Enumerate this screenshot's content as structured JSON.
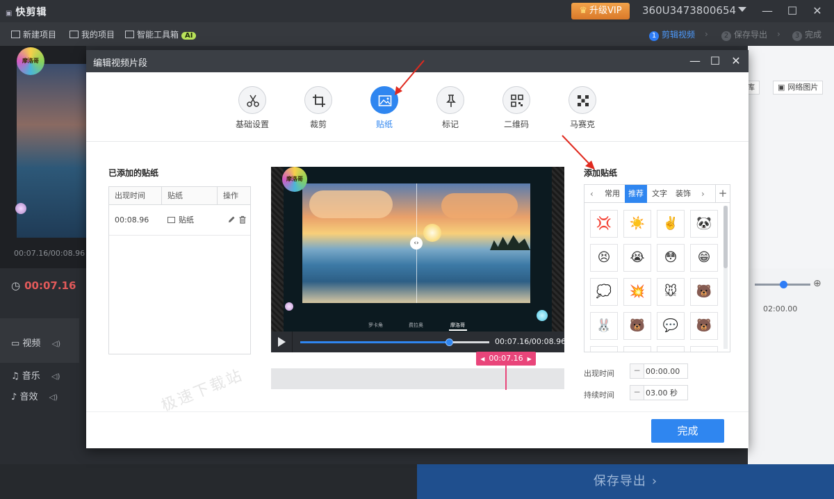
{
  "app": {
    "title": "快剪辑",
    "vip_label": "升级VIP",
    "user_id": "360U3473800654"
  },
  "toolbar": {
    "new_project": "新建项目",
    "my_projects": "我的项目",
    "smart_toolbox": "智能工具箱",
    "ai_badge": "AI",
    "steps": [
      {
        "num": "1",
        "label": "剪辑视频"
      },
      {
        "num": "2",
        "label": "保存导出"
      },
      {
        "num": "3",
        "label": "完成"
      }
    ]
  },
  "background": {
    "preview_time": "00:07.16/00:08.96",
    "timeline_time": "00:07.16",
    "ruler_time": "02:00.00",
    "right_buttons": [
      "库",
      "网络图片"
    ],
    "tracks": [
      "视频",
      "音乐",
      "音效"
    ],
    "save_export": "保存导出",
    "logo_text": "摩洛哥"
  },
  "modal": {
    "title": "编辑视频片段",
    "tabs": [
      {
        "label": "基础设置",
        "icon": "scissors-icon"
      },
      {
        "label": "裁剪",
        "icon": "crop-icon"
      },
      {
        "label": "贴纸",
        "icon": "image-icon"
      },
      {
        "label": "标记",
        "icon": "pin-icon"
      },
      {
        "label": "二维码",
        "icon": "qrcode-icon"
      },
      {
        "label": "马赛克",
        "icon": "mosaic-icon"
      }
    ],
    "active_tab": "贴纸",
    "added_stickers": {
      "title": "已添加的贴纸",
      "columns": [
        "出现时间",
        "贴纸",
        "操作"
      ],
      "rows": [
        {
          "time": "00:08.96",
          "sticker": "贴纸"
        }
      ]
    },
    "player": {
      "time": "00:07.16/00:08.96",
      "progress": 0.79,
      "marker_time": "00:07.16",
      "logo_text": "摩洛哥",
      "subtitles": [
        "罗卡角",
        "费拉奥",
        "摩洛哥"
      ]
    },
    "add_sticker": {
      "title": "添加贴纸",
      "tabs": [
        "常用",
        "推荐",
        "文字",
        "装饰"
      ],
      "active_tab": "推荐",
      "stickers": [
        "💢",
        "☀️",
        "✌️",
        "🐼",
        "😣",
        "😭",
        "😳",
        "😁",
        "💭",
        "💥",
        "🐭",
        "🐻",
        "🐰",
        "🐻",
        "💬",
        "🐻"
      ]
    },
    "appear_time_label": "出现时间",
    "appear_time_value": "00:00.00",
    "duration_label": "持续时间",
    "duration_value": "03.00 秒",
    "done_label": "完成"
  },
  "watermark": "极速下载站",
  "colors": {
    "accent": "#2f86f0",
    "marker": "#e9457a",
    "vip": "#e38a36"
  }
}
